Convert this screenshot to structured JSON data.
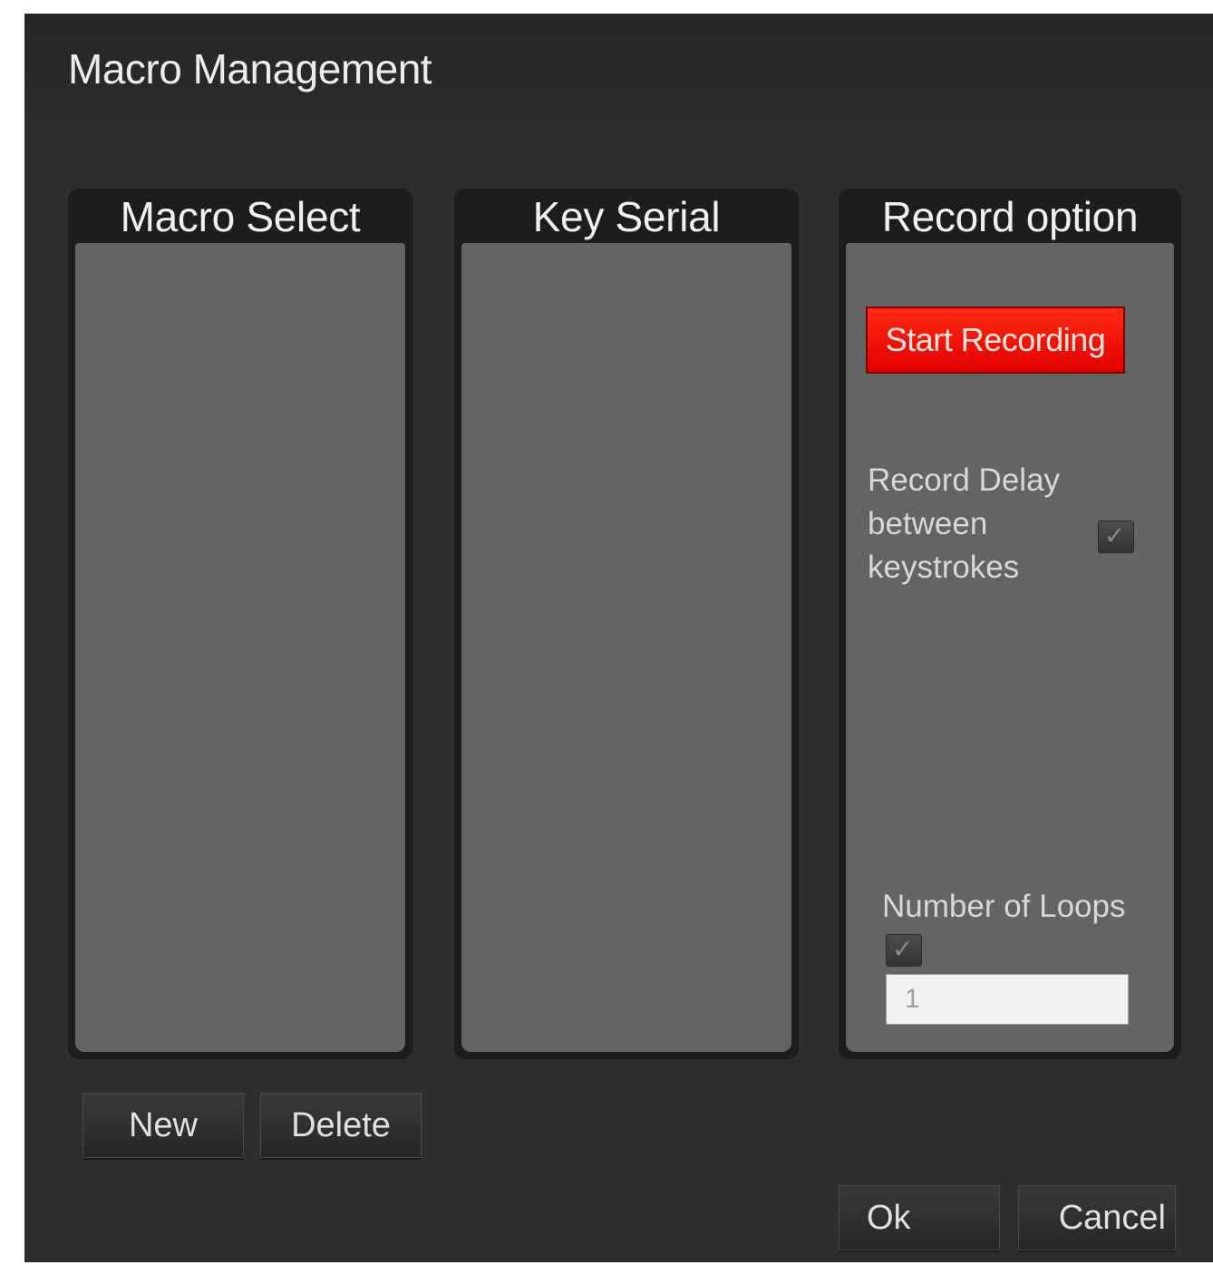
{
  "window": {
    "title": "Macro Management"
  },
  "panels": {
    "macro_select": {
      "header": "Macro Select"
    },
    "key_serial": {
      "header": "Key Serial"
    },
    "record_option": {
      "header": "Record option",
      "start_recording_label": "Start Recording",
      "record_delay_label": "Record Delay between keystrokes",
      "record_delay_checked": true,
      "number_of_loops_label": "Number of Loops",
      "number_of_loops_checked": true,
      "number_of_loops_value": "1"
    }
  },
  "buttons": {
    "new_label": "New",
    "delete_label": "Delete",
    "ok_label": "Ok",
    "cancel_label": "Cancel"
  },
  "colors": {
    "record_button": "#e60000",
    "panel_body": "#646464",
    "dialog_background": "#2e2e2e"
  },
  "icons": {
    "checkbox_mark": "checkmark-icon"
  }
}
